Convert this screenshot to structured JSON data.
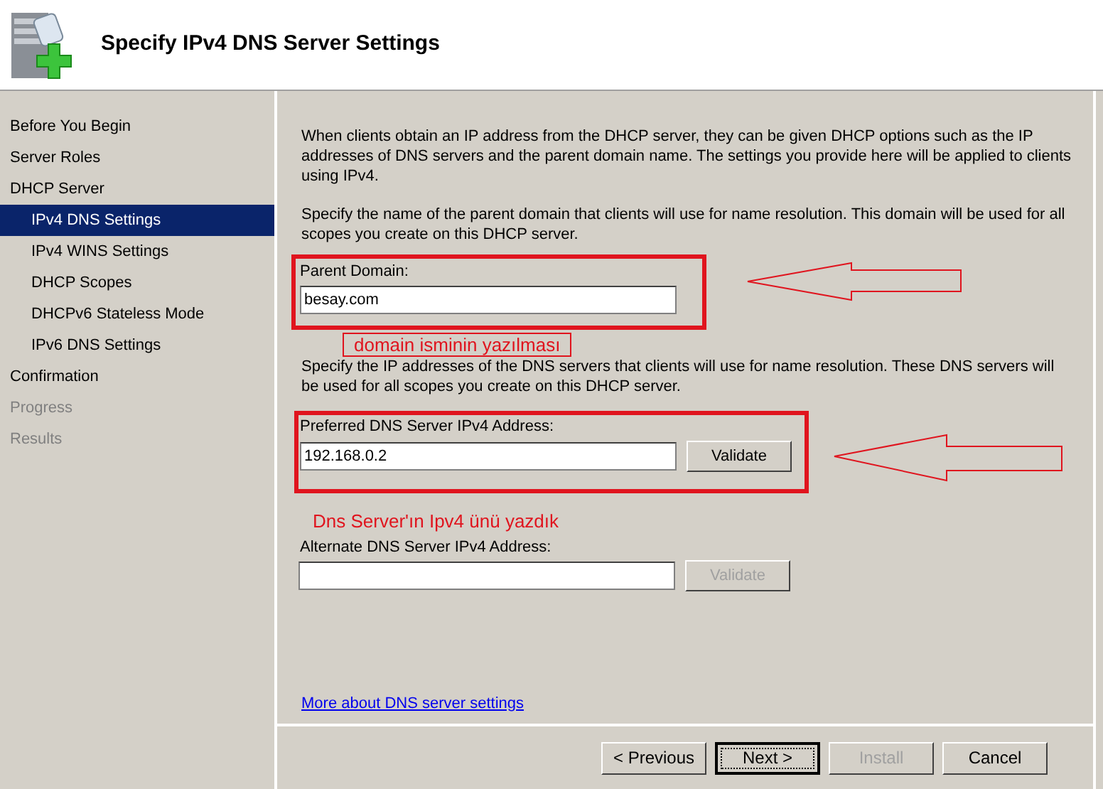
{
  "header": {
    "title": "Specify IPv4 DNS Server Settings"
  },
  "steps": [
    {
      "label": "Before You Begin",
      "selected": false,
      "disabled": false
    },
    {
      "label": "Server Roles",
      "selected": false,
      "disabled": false
    },
    {
      "label": "DHCP Server",
      "selected": false,
      "disabled": false,
      "children": [
        {
          "label": "IPv4 DNS Settings",
          "selected": true,
          "disabled": false
        },
        {
          "label": "IPv4 WINS Settings",
          "selected": false,
          "disabled": false
        },
        {
          "label": "DHCP Scopes",
          "selected": false,
          "disabled": false
        },
        {
          "label": "DHCPv6 Stateless Mode",
          "selected": false,
          "disabled": false
        },
        {
          "label": "IPv6 DNS Settings",
          "selected": false,
          "disabled": false
        }
      ]
    },
    {
      "label": "Confirmation",
      "selected": false,
      "disabled": false
    },
    {
      "label": "Progress",
      "selected": false,
      "disabled": true
    },
    {
      "label": "Results",
      "selected": false,
      "disabled": true
    }
  ],
  "content": {
    "intro": "When clients obtain an IP address from the DHCP server, they can be given DHCP options such as the IP addresses of DNS servers and the parent domain name. The settings you provide here will be applied to clients using IPv4.",
    "domain_hint": "Specify the name of the parent domain that clients will use for name resolution. This domain will be used for all scopes you create on this DHCP server.",
    "parent_domain": {
      "label": "Parent Domain:",
      "value": "besay.com"
    },
    "note_1": "domain isminin yazılması",
    "dns_hint": "Specify the IP addresses of the DNS servers that clients will use for name resolution. These DNS servers will be used for all scopes you create on this DHCP server.",
    "preferred": {
      "label": "Preferred DNS Server IPv4 Address:",
      "value": "192.168.0.2",
      "button": {
        "label": "Validate",
        "disabled": false
      }
    },
    "note_2": "Dns Server'ın Ipv4 ünü yazdık",
    "alternate": {
      "label": "Alternate DNS Server IPv4 Address:",
      "button": {
        "label": "Validate",
        "disabled": true
      }
    },
    "link": "More about DNS server settings"
  },
  "buttons": [
    {
      "label": "< Previous",
      "disabled": false,
      "default": false
    },
    {
      "label": "Next >",
      "disabled": false,
      "default": true
    },
    {
      "label": "Install",
      "disabled": true,
      "default": false
    },
    {
      "label": "Cancel",
      "disabled": false,
      "default": false
    }
  ]
}
